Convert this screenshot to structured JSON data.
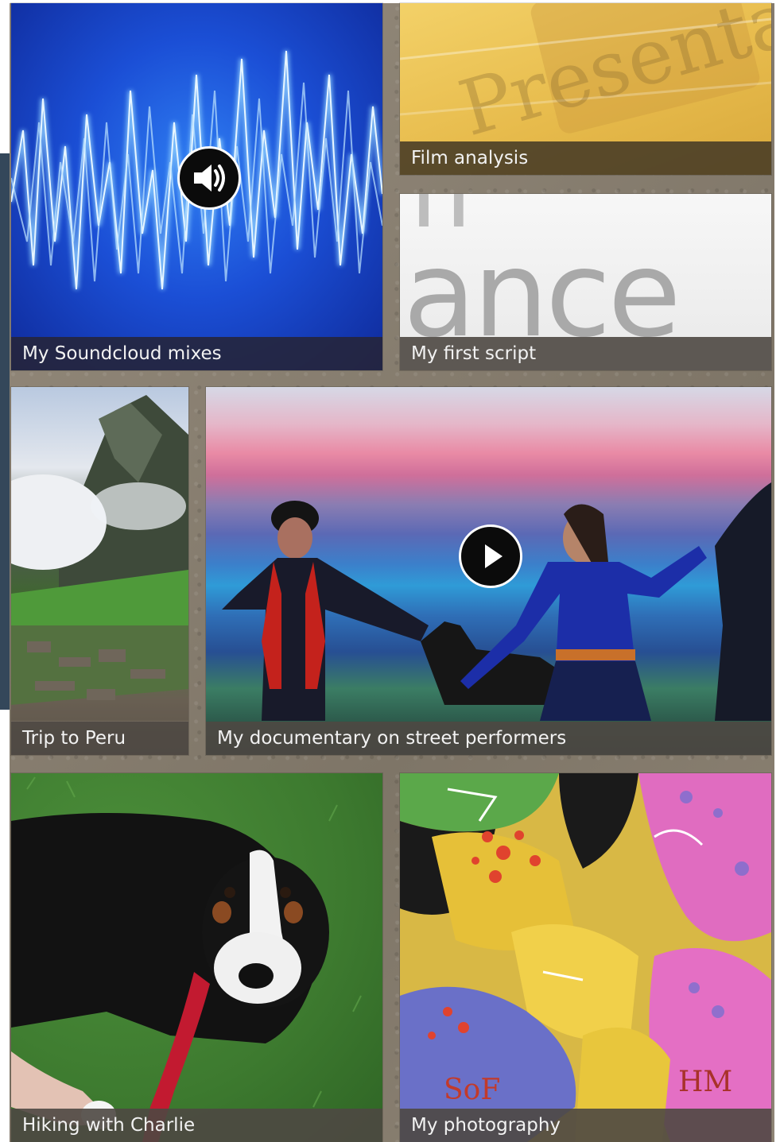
{
  "tiles": [
    {
      "id": "soundcloud",
      "caption": "My Soundcloud mixes",
      "overlay_icon": "speaker-icon"
    },
    {
      "id": "film",
      "caption": "Film analysis",
      "artwork_text": "Presenta"
    },
    {
      "id": "script",
      "caption": "My first script",
      "artwork_text": "ance"
    },
    {
      "id": "peru",
      "caption": "Trip to Peru"
    },
    {
      "id": "documentary",
      "caption": "My documentary on street performers",
      "overlay_icon": "play-icon"
    },
    {
      "id": "charlie",
      "caption": "Hiking with Charlie"
    },
    {
      "id": "photography",
      "caption": "My photography",
      "artwork_text": [
        "SoF",
        "HM"
      ]
    }
  ],
  "colors": {
    "board": "#8c8274",
    "caption_dark": "#262438",
    "caption_brown": "#463a26",
    "sidebar_strip": "#34475a"
  }
}
